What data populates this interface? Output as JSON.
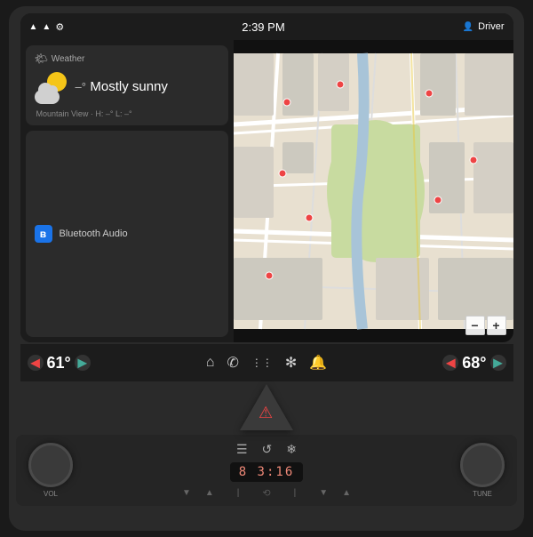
{
  "status_bar": {
    "time": "2:39 PM",
    "driver_label": "Driver",
    "wifi_icon": "wifi",
    "signal_icon": "signal",
    "settings_icon": "⚙"
  },
  "weather": {
    "title": "Weather",
    "condition": "Mostly sunny",
    "temperature_prefix": "–°",
    "sub_info": "Mountain View · H: –° L: –°"
  },
  "bluetooth": {
    "title": "Bluetooth Audio"
  },
  "map": {
    "zoom_minus": "−",
    "zoom_plus": "+"
  },
  "control_bar": {
    "temp_left": "61°",
    "temp_right": "68°",
    "icons": [
      "◄",
      "►",
      "⌂",
      "✆",
      "⋮⋮⋮",
      "❄",
      "🔔",
      "◄",
      "►"
    ]
  },
  "hvac": {
    "display": "8 3:16",
    "vol_label": "VOL",
    "tune_label": "TUNE"
  }
}
